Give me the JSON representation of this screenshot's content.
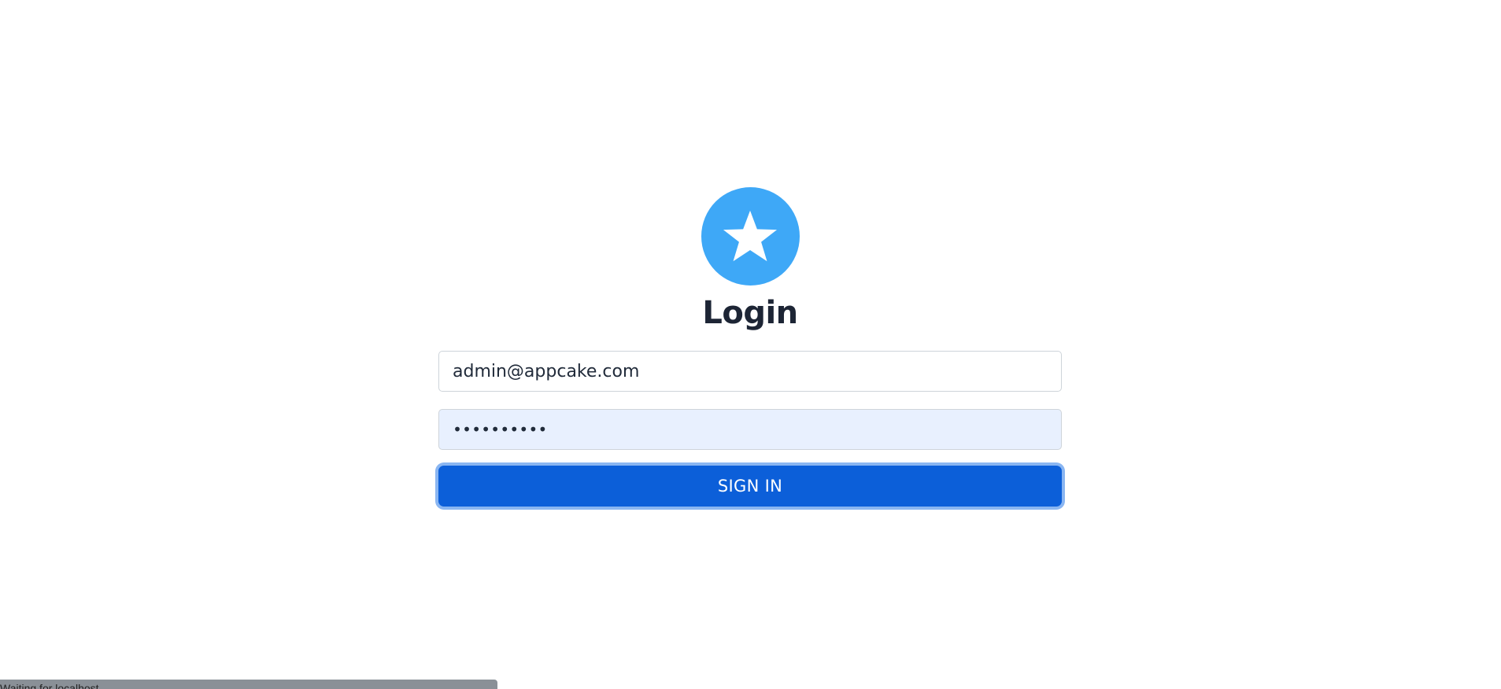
{
  "login": {
    "logo_icon": "star-icon",
    "logo_color": "#3ea8f7",
    "title": "Login",
    "email": {
      "value": "admin@appcake.com"
    },
    "password": {
      "masked_value": "••••••••••"
    },
    "sign_in_label": "SIGN IN",
    "button_color": "#0c5fd9"
  },
  "browser_status": {
    "text": "Waiting for localhost..."
  }
}
